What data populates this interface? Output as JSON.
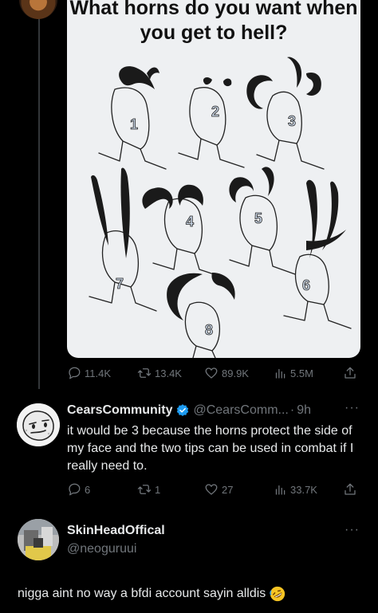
{
  "original_tweet": {
    "image": {
      "title_line1": "What horns do you want when",
      "title_line2": "you get to hell?",
      "option_numbers": [
        "1",
        "2",
        "3",
        "4",
        "5",
        "7",
        "6",
        "8"
      ]
    },
    "stats": {
      "replies": "11.4K",
      "reposts": "13.4K",
      "likes": "89.9K",
      "views": "5.5M"
    }
  },
  "reply1": {
    "display_name": "CearsCommunity",
    "handle": "@CearsComm...",
    "separator": "·",
    "time": "9h",
    "text": "it would be 3 because the horns protect the side of my face and the two tips can be used in combat if I really need to.",
    "stats": {
      "replies": "6",
      "reposts": "1",
      "likes": "27",
      "views": "33.7K"
    }
  },
  "reply2": {
    "display_name": "SkinHeadOffical",
    "handle": "@neoguruui",
    "text": "nigga aint no way a bfdi account sayin alldis"
  },
  "colors": {
    "background": "#000000",
    "text_primary": "#e7e9ea",
    "text_secondary": "#71767b",
    "verified_blue": "#1d9bf0"
  }
}
